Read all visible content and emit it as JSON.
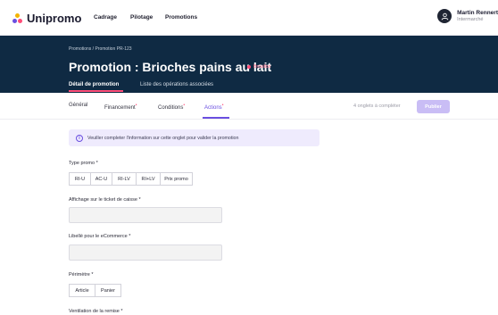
{
  "app": {
    "logo": "Unipromo"
  },
  "nav": {
    "items": [
      "Cadrage",
      "Pilotage",
      "Promotions"
    ]
  },
  "user": {
    "name": "Martin Rennert",
    "org": "Intermarché"
  },
  "header": {
    "breadcrumb": "Promotions / Promotion PR-123",
    "title": "Promotion : Brioches pains au lait",
    "status": "Brouillon",
    "tabs": [
      "Détail de promotion",
      "Liste des opérations associées"
    ]
  },
  "subtabs": {
    "items": [
      "Général",
      "Financement",
      "Conditions",
      "Actions"
    ],
    "active": "Actions",
    "remaining": "4 onglets à compléter",
    "publish_label": "Publier"
  },
  "alert": {
    "text": "Veuiller completer l'information sur cette onglet pour valider la promotion"
  },
  "form": {
    "type_promo_label": "Type promo *",
    "type_promo_options": [
      "RI-U",
      "AC-U",
      "RI-LV",
      "RI+LV",
      "Prix promo"
    ],
    "ticket_label": "Affichage sur le ticket de caisse *",
    "ecommerce_label": "Libellé pour le eCommerce *",
    "perimetre_label": "Périmètre *",
    "perimetre_options": [
      "Article",
      "Panier"
    ],
    "ventilation_label": "Ventilation de la remise *"
  },
  "colors": {
    "header_bg": "#0f2a43",
    "accent": "#6a4fe0",
    "status": "#ff4d78",
    "publish_disabled": "#c9bdf5"
  }
}
